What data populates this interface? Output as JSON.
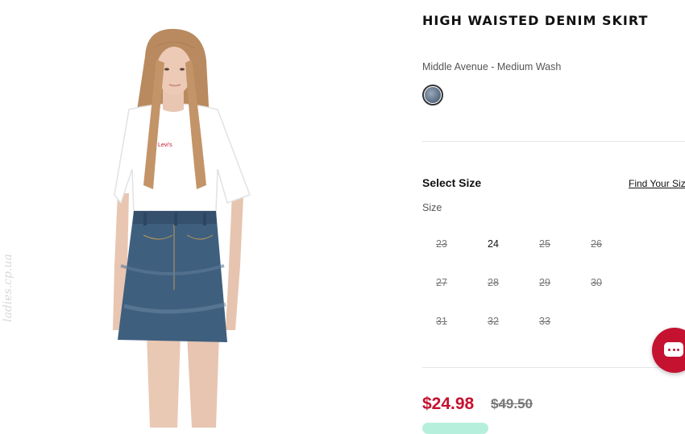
{
  "product": {
    "title": "HIGH WAISTED DENIM SKIRT",
    "color_name": "Middle Avenue - Medium Wash",
    "shirt_logo": "Levi's"
  },
  "watermark": "ladies.cp.ua",
  "size_section": {
    "heading": "Select Size",
    "find_size_link": "Find Your Size",
    "label": "Size",
    "sizes": [
      {
        "label": "23",
        "available": false
      },
      {
        "label": "24",
        "available": true
      },
      {
        "label": "25",
        "available": false
      },
      {
        "label": "26",
        "available": false
      },
      {
        "label": "27",
        "available": false
      },
      {
        "label": "28",
        "available": false
      },
      {
        "label": "29",
        "available": false
      },
      {
        "label": "30",
        "available": false
      },
      {
        "label": "31",
        "available": false
      },
      {
        "label": "32",
        "available": false
      },
      {
        "label": "33",
        "available": false
      }
    ]
  },
  "pricing": {
    "sale_price": "$24.98",
    "original_price": "$49.50"
  },
  "colors": {
    "accent_red": "#c41230",
    "swatch": "#5f7189",
    "promo_mint": "#b6f0dc"
  },
  "icons": {
    "chat": "chat-bubble-icon",
    "swatch": "color-swatch"
  }
}
